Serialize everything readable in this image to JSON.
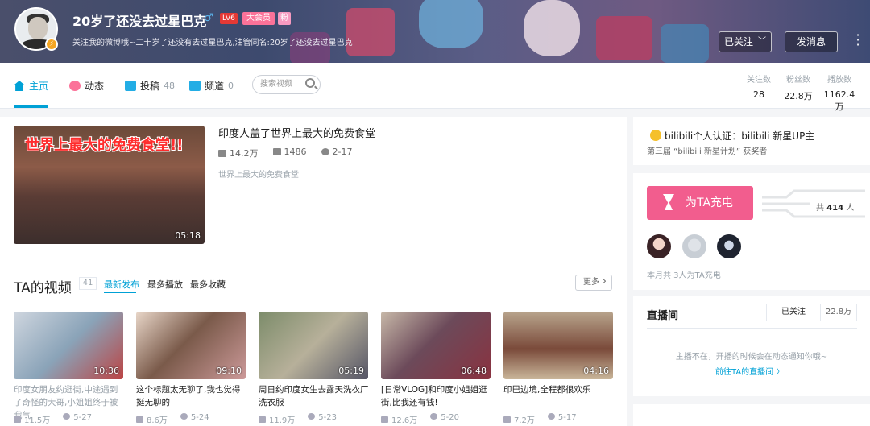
{
  "profile": {
    "username": "20岁了还没去过星巴克",
    "gender_symbol": "♂",
    "level": "LV6",
    "vip": "大会员",
    "tag": "粉",
    "signature": "关注我的微博哦~二十岁了还没有去过星巴克,油管同名:20岁了还没去过星巴克",
    "follow_button": "已关注",
    "message_button": "发消息",
    "more_icon": "⋮"
  },
  "nav": {
    "tabs": [
      {
        "label": "主页",
        "count": ""
      },
      {
        "label": "动态",
        "count": ""
      },
      {
        "label": "投稿",
        "count": "48"
      },
      {
        "label": "频道",
        "count": "0"
      }
    ],
    "search_placeholder": "搜索视频",
    "stats": [
      {
        "label": "关注数",
        "value": "28"
      },
      {
        "label": "粉丝数",
        "value": "22.8万"
      },
      {
        "label": "播放数",
        "value": "1162.4万"
      }
    ]
  },
  "featured": {
    "title": "印度人盖了世界上最大的免费食堂",
    "plays": "14.2万",
    "danmaku": "1486",
    "date": "2-17",
    "description": "世界上最大的免费食堂",
    "duration": "05:18",
    "thumb_text": "世界上最大的免费食堂!!"
  },
  "videos_section": {
    "title": "TA的视频",
    "count": "41",
    "sort_options": [
      "最新发布",
      "最多播放",
      "最多收藏"
    ],
    "more": "更多"
  },
  "videos": [
    {
      "title": "印度女朋友约逛街,中途遇到了奇怪的大哥,小姐姐终于被我气",
      "duration": "10:36",
      "plays": "11.5万",
      "date": "5-27"
    },
    {
      "title": "这个标题太无聊了,我也觉得挺无聊的",
      "duration": "09:10",
      "plays": "8.6万",
      "date": "5-24"
    },
    {
      "title": "周日约印度女生去露天洗衣厂洗衣服",
      "duration": "05:19",
      "plays": "11.9万",
      "date": "5-23"
    },
    {
      "title": "[日常VLOG]和印度小姐姐逛街,比我还有钱!",
      "duration": "06:48",
      "plays": "12.6万",
      "date": "5-20"
    },
    {
      "title": "印巴边境,全程都很欢乐",
      "duration": "04:16",
      "plays": "7.2万",
      "date": "5-17"
    }
  ],
  "certification": {
    "text": "bilibili个人认证：bilibili 新星UP主",
    "sub": "第三届 “bilibili 新星计划” 获奖者"
  },
  "charge": {
    "button": "为TA充电",
    "total_prefix": "共",
    "total_value": "414",
    "total_suffix": "人",
    "note": "本月共 3人为TA充电"
  },
  "live": {
    "title": "直播间",
    "followed": "已关注",
    "count": "22.8万",
    "empty": "主播不在，开播的时候会在动态通知你哦~",
    "link": "前往TA的直播间 〉"
  },
  "colors": {
    "accent": "#00a1d6",
    "pink": "#fb7299",
    "charge": "#f25d8e"
  }
}
